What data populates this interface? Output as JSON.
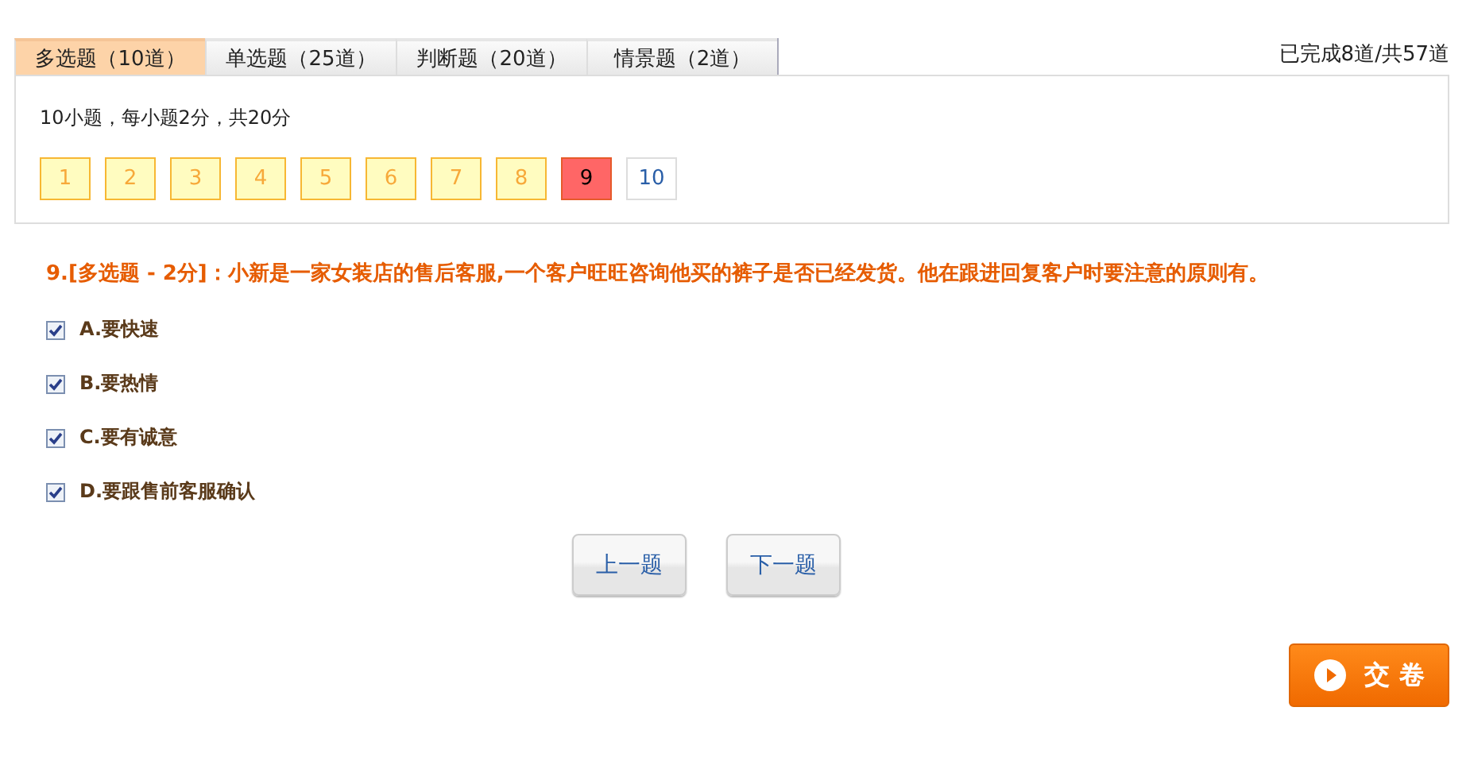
{
  "tabs": [
    {
      "label": "多选题（10道）",
      "selected": true
    },
    {
      "label": "单选题（25道）",
      "selected": false
    },
    {
      "label": "判断题（20道）",
      "selected": false
    },
    {
      "label": "情景题（2道）",
      "selected": false
    }
  ],
  "progress": "已完成8道/共57道",
  "summary": "10小题，每小题2分，共20分",
  "question_numbers": [
    {
      "label": "1",
      "answered": true,
      "selected": false
    },
    {
      "label": "2",
      "answered": true,
      "selected": false
    },
    {
      "label": "3",
      "answered": true,
      "selected": false
    },
    {
      "label": "4",
      "answered": true,
      "selected": false
    },
    {
      "label": "5",
      "answered": true,
      "selected": false
    },
    {
      "label": "6",
      "answered": true,
      "selected": false
    },
    {
      "label": "7",
      "answered": true,
      "selected": false
    },
    {
      "label": "8",
      "answered": true,
      "selected": false
    },
    {
      "label": "9",
      "answered": false,
      "selected": true
    },
    {
      "label": "10",
      "answered": false,
      "selected": false
    }
  ],
  "question": "9.[多选题 - 2分]：小新是一家女装店的售后客服,一个客户旺旺咨询他买的裤子是否已经发货。他在跟进回复客户时要注意的原则有。",
  "options": [
    {
      "label": "A.要快速",
      "checked": true
    },
    {
      "label": "B.要热情",
      "checked": true
    },
    {
      "label": "C.要有诚意",
      "checked": true
    },
    {
      "label": "D.要跟售前客服确认",
      "checked": true
    }
  ],
  "nav_buttons": [
    "上一题",
    "下一题"
  ],
  "submit_button": "交 卷"
}
